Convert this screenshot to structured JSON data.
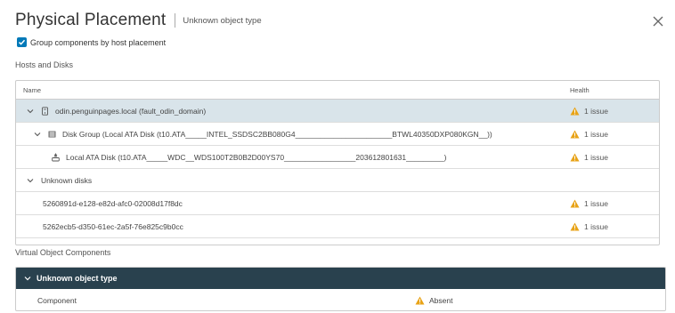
{
  "dialog": {
    "title": "Physical Placement",
    "subtitle": "Unknown object type",
    "group_checkbox_label": "Group components by host placement",
    "group_checkbox_checked": true
  },
  "hosts_and_disks": {
    "section_label": "Hosts and Disks",
    "columns": {
      "name": "Name",
      "health": "Health"
    },
    "rows": [
      {
        "label": "odin.penguinpages.local (fault_odin_domain)",
        "health": "1 issue",
        "icon": "host-icon",
        "expanded": true,
        "selected": true
      },
      {
        "label": "Disk Group (Local ATA Disk (t10.ATA_____INTEL_SSDSC2BB080G4_______________________BTWL40350DXP080KGN__))",
        "health": "1 issue",
        "icon": "disk-group-icon",
        "expanded": true
      },
      {
        "label": "Local ATA Disk (t10.ATA_____WDC__WDS100T2B0B2D00YS70_________________203612801631_________)",
        "health": "1 issue",
        "icon": "disk-icon"
      },
      {
        "label": "Unknown disks",
        "health": "",
        "expanded": true
      },
      {
        "label": "5260891d-e128-e82d-afc0-02008d17f8dc",
        "health": "1 issue"
      },
      {
        "label": "5262ecb5-d350-61ec-2a5f-76e825c9b0cc",
        "health": "1 issue"
      }
    ]
  },
  "virtual_objects": {
    "section_label": "Virtual Object Components",
    "group_title": "Unknown object type",
    "rows": [
      {
        "component": "Component",
        "state": "Absent"
      }
    ]
  },
  "colors": {
    "accent": "#0079b8",
    "selected_row": "#d9e4ea",
    "group_header": "#29414e",
    "warning": "#e8a317"
  }
}
